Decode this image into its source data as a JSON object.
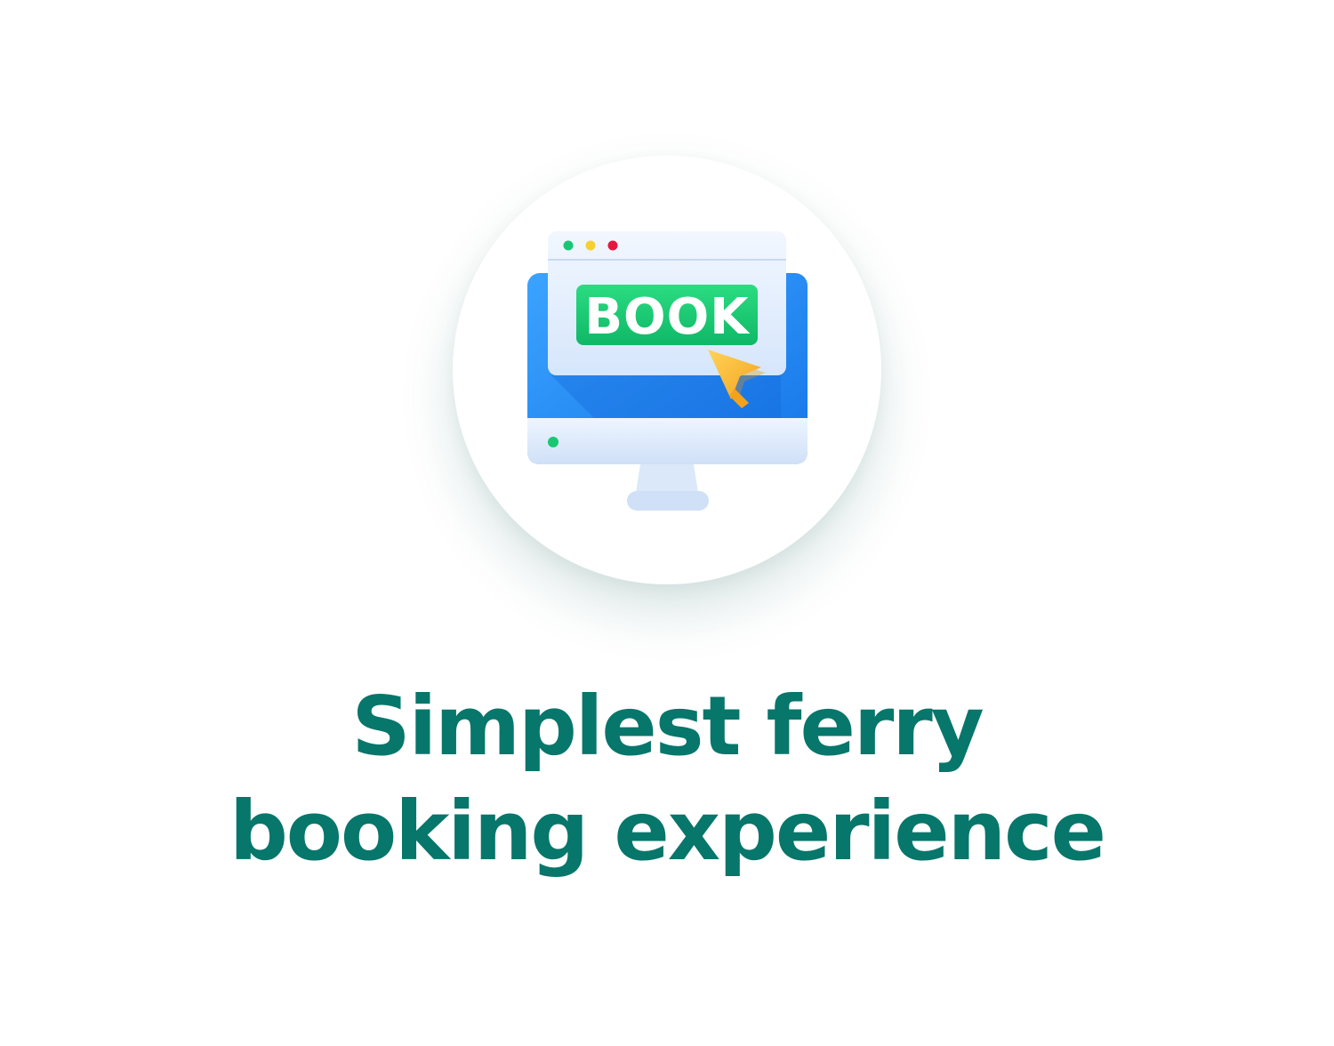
{
  "illustration": {
    "button_label": "BOOK",
    "icons": [
      "monitor-icon",
      "browser-window-icon",
      "cursor-arrow-icon"
    ]
  },
  "headline": {
    "line1": "Simplest ferry",
    "line2": "booking experience"
  },
  "colors": {
    "headline": "#07766B",
    "button": "#16C66F",
    "screen": "#1E88F0",
    "cursor": "#F7B52C"
  }
}
